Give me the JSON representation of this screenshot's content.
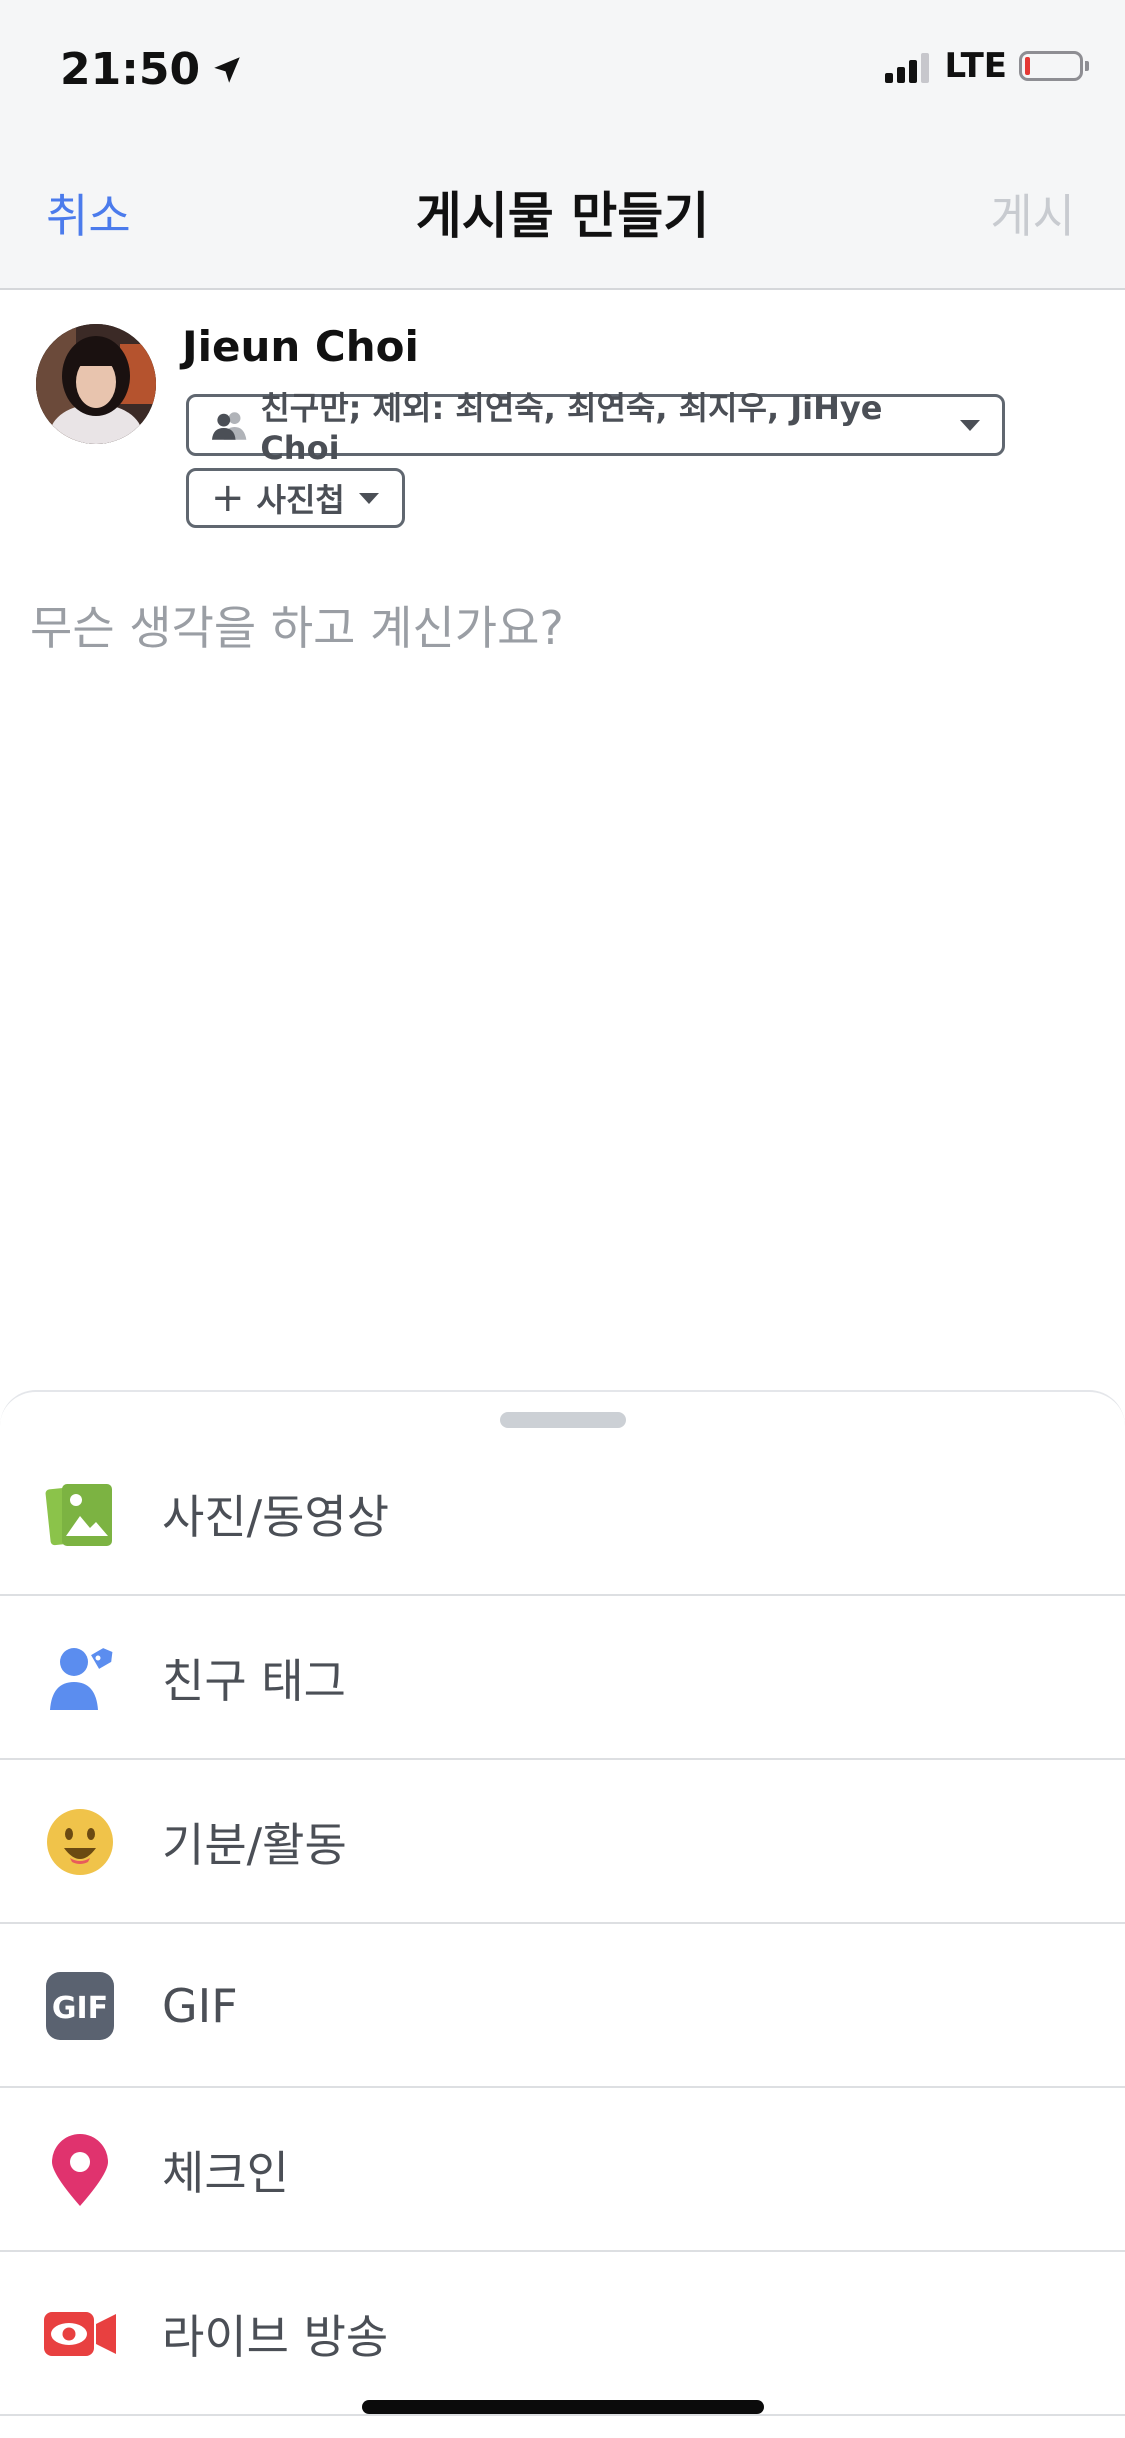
{
  "status_bar": {
    "time": "21:50",
    "network": "LTE",
    "battery_color": "#e53935"
  },
  "nav": {
    "cancel": "취소",
    "title": "게시물 만들기",
    "post": "게시"
  },
  "author": {
    "name": "Jieun Choi"
  },
  "audience": {
    "label": "친구만; 제외: 최연숙, 최연숙, 최지우, JiHye  Choi"
  },
  "album": {
    "label": "사진첩"
  },
  "composer": {
    "placeholder": "무슨 생각을 하고 계신가요?"
  },
  "actions": [
    {
      "label": "사진/동영상",
      "icon": "photo-icon",
      "color": "#7cb342"
    },
    {
      "label": "친구 태그",
      "icon": "tag-friends-icon",
      "color": "#5b8def"
    },
    {
      "label": "기분/활동",
      "icon": "feeling-icon",
      "color": "#f0c34a"
    },
    {
      "label": "GIF",
      "icon": "gif-icon",
      "color": "#5a6270"
    },
    {
      "label": "체크인",
      "icon": "location-pin-icon",
      "color": "#e0336e"
    },
    {
      "label": "라이브 방송",
      "icon": "live-video-icon",
      "color": "#e84040"
    }
  ],
  "colors": {
    "accent": "#4b7bec",
    "disabled": "#c8cbd0"
  }
}
